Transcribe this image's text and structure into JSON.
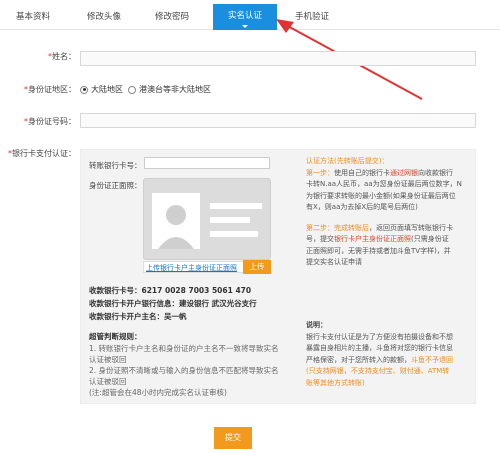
{
  "tabs": [
    {
      "label": "基本资料"
    },
    {
      "label": "修改头像"
    },
    {
      "label": "修改密码"
    },
    {
      "label": "实名认证",
      "active": true
    },
    {
      "label": "手机验证"
    }
  ],
  "colors": {
    "accent": "#1a8fe0",
    "orange": "#f39a1e",
    "required": "#d9342b",
    "arrow": "#e03333"
  },
  "form": {
    "name_label": "姓名：",
    "region_label": "身份证地区：",
    "region_options": [
      {
        "label": "大陆地区",
        "selected": true
      },
      {
        "label": "港澳台等非大陆地区",
        "selected": false
      }
    ],
    "id_label": "身份证号码：",
    "bank_label": "银行卡支付认证："
  },
  "bank": {
    "card_label": "转账银行卡号：",
    "photo_label": "身份证正面照：",
    "upload_link": "上传银行卡户主身份证正面照",
    "upload_button": "上传",
    "account_no": "收款银行卡号：6217 0028 7003 5061 470",
    "account_bank": "收款银行卡开户银行信息：建设银行 武汉光谷支行",
    "account_holder": "收款银行卡开户主名：吴一帆",
    "rules_title": "超管判断规则：",
    "rules": [
      "1. 转账银行卡户主名和身份证的户主名不一致将导致实名",
      "认证被驳回",
      "2. 身份证照不清晰或与输入的身份信息不匹配将导致实名",
      "认证被驳回",
      "(注:超管会在48小时内完成实名认证审核)"
    ]
  },
  "side": {
    "method_title": "认证方法(先转账后提交)：",
    "step1_a": "第一步：",
    "step1_b": "使用自己的银行卡",
    "step1_c": "通过网银",
    "step1_d": "向收款银行",
    "step1_lines": [
      "卡转N.aa人民币，aa为您身份证最后两位数字，N",
      "为银行要求转账的最小金额(如果身份证最后两位",
      "有X，则aa为去掉X后的尾号后两位)"
    ],
    "step2_a": "第二步：",
    "step2_b": "完成转账后",
    "step2_c": "，返回页面填写转账银行卡",
    "step2_line2_a": "号，提交",
    "step2_line2_b": "银行卡户主身份证正面照",
    "step2_line2_c": "(只需身份证",
    "step2_lines": [
      "正面照即可，无需手持或者加斗鱼TV字样)，并",
      "提交实名认证申请"
    ],
    "note_title": "说明：",
    "note_lines": [
      "银行卡支付认证是为了方便没有拍摄设备和不想",
      "暴露自身相片的主播，斗鱼将对您的银行卡信息"
    ],
    "note_line3_a": "严格保密，对于您所转入的款额，",
    "note_line3_b": "斗鱼不予退回",
    "note_red_lines": [
      "(只支持网银，不支持支付宝、财付通、ATM转",
      "账等其他方式转账)"
    ]
  },
  "submit_label": "提交"
}
